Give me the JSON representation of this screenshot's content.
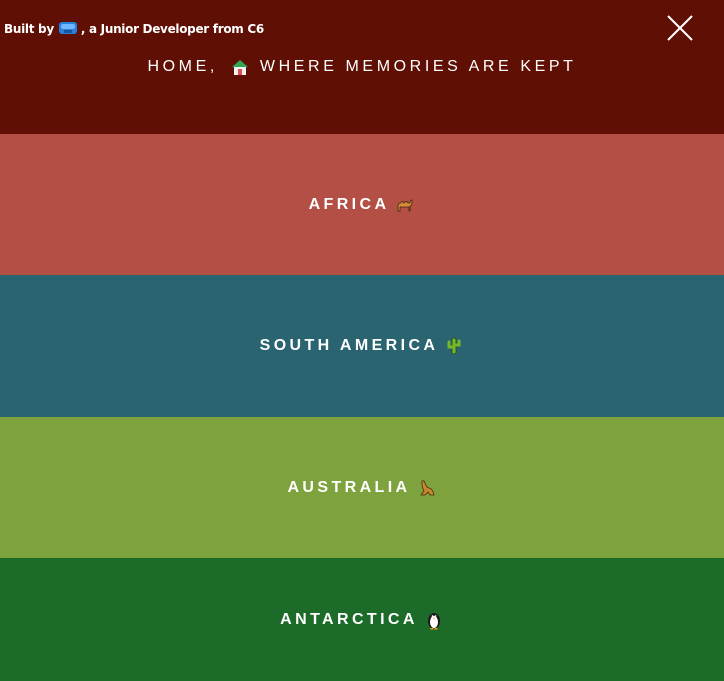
{
  "header": {
    "credit_prefix": "Built by",
    "credit_suffix": ", a Junior Developer from C6",
    "title_prefix": "HOME,",
    "title_suffix": "WHERE MEMORIES ARE KEPT",
    "home_icon": "house-icon",
    "close_icon": "close-icon",
    "background": "#5f0f04"
  },
  "continents": [
    {
      "label": "AFRICA",
      "icon": "camel-icon",
      "color": "#b34f44"
    },
    {
      "label": "SOUTH AMERICA",
      "icon": "cactus-icon",
      "color": "#2a6470"
    },
    {
      "label": "AUSTRALIA",
      "icon": "kangaroo-icon",
      "color": "#7ea33e"
    },
    {
      "label": "ANTARCTICA",
      "icon": "penguin-icon",
      "color": "#1c6b28"
    }
  ]
}
